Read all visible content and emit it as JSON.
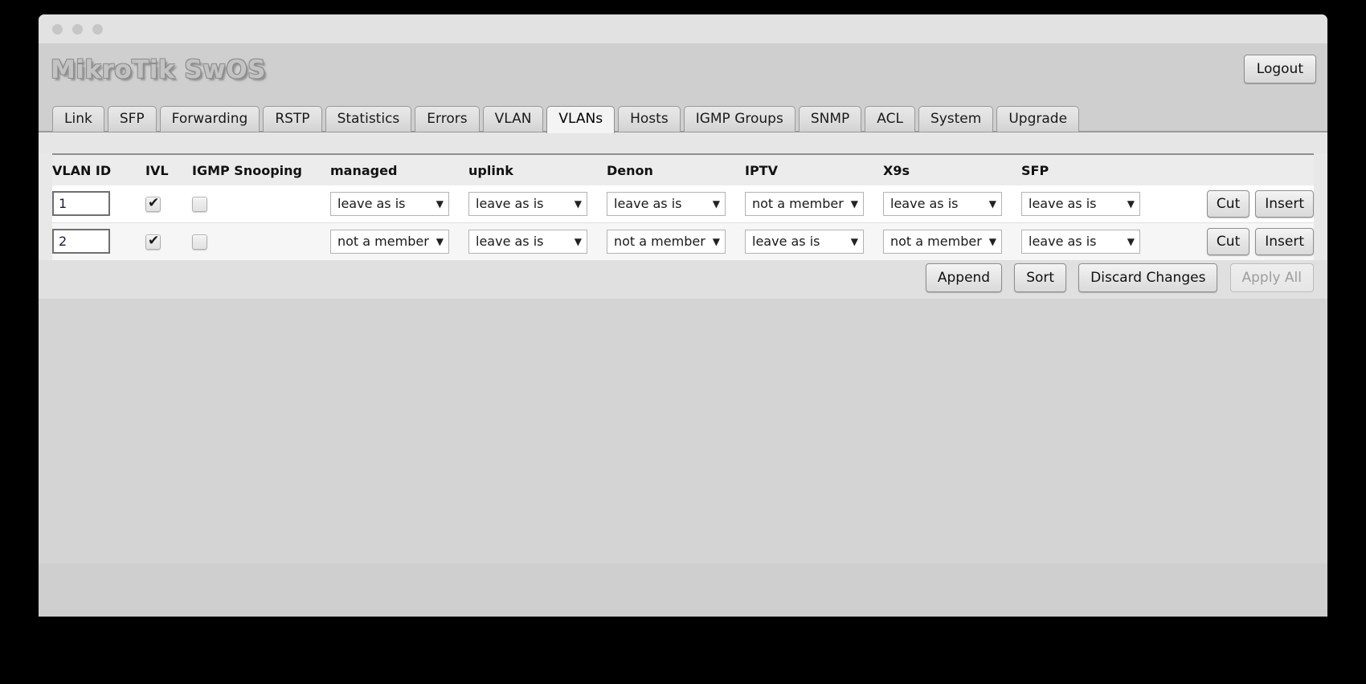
{
  "window": {
    "traffic_lights": [
      "close",
      "minimize",
      "maximize"
    ]
  },
  "header": {
    "brand": "MikroTik SwOS",
    "logout_label": "Logout"
  },
  "tabs": [
    {
      "label": "Link",
      "active": false
    },
    {
      "label": "SFP",
      "active": false
    },
    {
      "label": "Forwarding",
      "active": false
    },
    {
      "label": "RSTP",
      "active": false
    },
    {
      "label": "Statistics",
      "active": false
    },
    {
      "label": "Errors",
      "active": false
    },
    {
      "label": "VLAN",
      "active": false
    },
    {
      "label": "VLANs",
      "active": true
    },
    {
      "label": "Hosts",
      "active": false
    },
    {
      "label": "IGMP Groups",
      "active": false
    },
    {
      "label": "SNMP",
      "active": false
    },
    {
      "label": "ACL",
      "active": false
    },
    {
      "label": "System",
      "active": false
    },
    {
      "label": "Upgrade",
      "active": false
    }
  ],
  "table": {
    "columns": [
      "VLAN ID",
      "IVL",
      "IGMP Snooping",
      "managed",
      "uplink",
      "Denon",
      "IPTV",
      "X9s",
      "SFP"
    ],
    "rows": [
      {
        "vlan_id": "1",
        "ivl": true,
        "igmp_snooping": false,
        "managed": "leave as is",
        "uplink": "leave as is",
        "denon": "leave as is",
        "iptv": "not a member",
        "x9s": "leave as is",
        "sfp": "leave as is",
        "cut_label": "Cut",
        "insert_label": "Insert"
      },
      {
        "vlan_id": "2",
        "ivl": true,
        "igmp_snooping": false,
        "managed": "not a member",
        "uplink": "leave as is",
        "denon": "not a member",
        "iptv": "leave as is",
        "x9s": "not a member",
        "sfp": "leave as is",
        "cut_label": "Cut",
        "insert_label": "Insert"
      }
    ]
  },
  "footer": {
    "append_label": "Append",
    "sort_label": "Sort",
    "discard_label": "Discard Changes",
    "apply_label": "Apply All",
    "apply_disabled": true
  },
  "icons": {
    "dropdown_arrow": "▼",
    "checkmark": "✔"
  },
  "colors": {
    "page_background": "#cfcfcf",
    "panel_background": "#e8e8e8",
    "row_a": "#ffffff",
    "row_b": "#f6f6f6",
    "desktop": "#000000"
  }
}
